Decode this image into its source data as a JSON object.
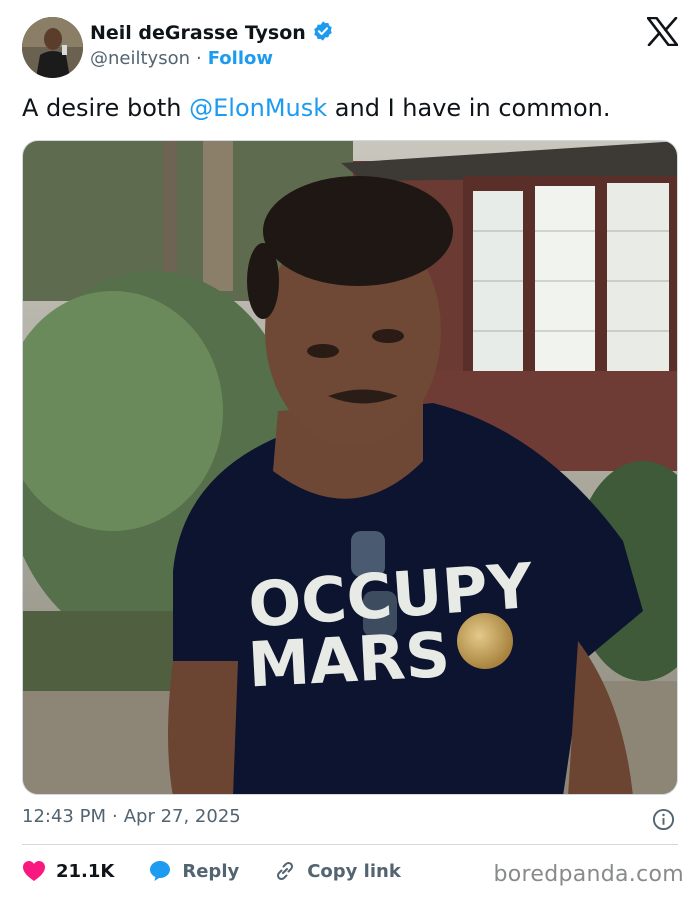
{
  "author": {
    "name": "Neil deGrasse Tyson",
    "handle": "@neiltyson",
    "separator": "·",
    "follow_label": "Follow",
    "verified": true
  },
  "tweet": {
    "text_before": "A desire both ",
    "mention": "@ElonMusk",
    "text_after": " and I have in common.",
    "photo_shirt_line1": "OCCUPY",
    "photo_shirt_line2": "MARS"
  },
  "meta": {
    "time": "12:43 PM",
    "separator": "·",
    "date": "Apr 27, 2025"
  },
  "actions": {
    "like_count": "21.1K",
    "reply_label": "Reply",
    "copy_link_label": "Copy link"
  },
  "watermark": "boredpanda.com",
  "colors": {
    "accent": "#1d9bf0",
    "like": "#f91880",
    "text_primary": "#0f1419",
    "text_secondary": "#536471"
  }
}
